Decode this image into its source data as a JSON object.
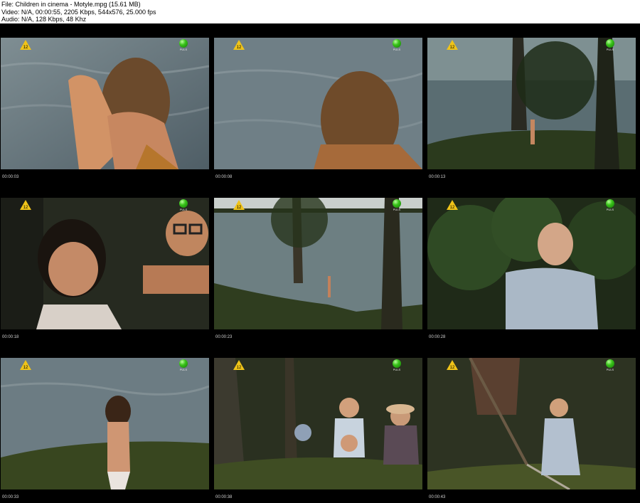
{
  "header": {
    "file_line": "File: Children in cinema - Motyle.mpg (15.61 MB)",
    "video_line": "Video: N/A, 00:00:55, 2205 Kbps, 544x576, 25.000 fps",
    "audio_line": "Audio: N/A, 128 Kbps, 48 Khz"
  },
  "overlay": {
    "rating": "12",
    "channel_label": "PULS"
  },
  "frames": [
    {
      "timestamp": "00:00:03",
      "description_icon": "girl-hair-icon"
    },
    {
      "timestamp": "00:00:08",
      "description_icon": "girl-back-icon"
    },
    {
      "timestamp": "00:00:13",
      "description_icon": "lake-shore-icon"
    },
    {
      "timestamp": "00:00:18",
      "description_icon": "boys-icon"
    },
    {
      "timestamp": "00:00:23",
      "description_icon": "lake-trees-icon"
    },
    {
      "timestamp": "00:00:28",
      "description_icon": "girl-bush-icon"
    },
    {
      "timestamp": "00:00:33",
      "description_icon": "girl-lake-icon"
    },
    {
      "timestamp": "00:00:38",
      "description_icon": "kids-forest-icon"
    },
    {
      "timestamp": "00:00:43",
      "description_icon": "girl-rake-icon"
    }
  ]
}
